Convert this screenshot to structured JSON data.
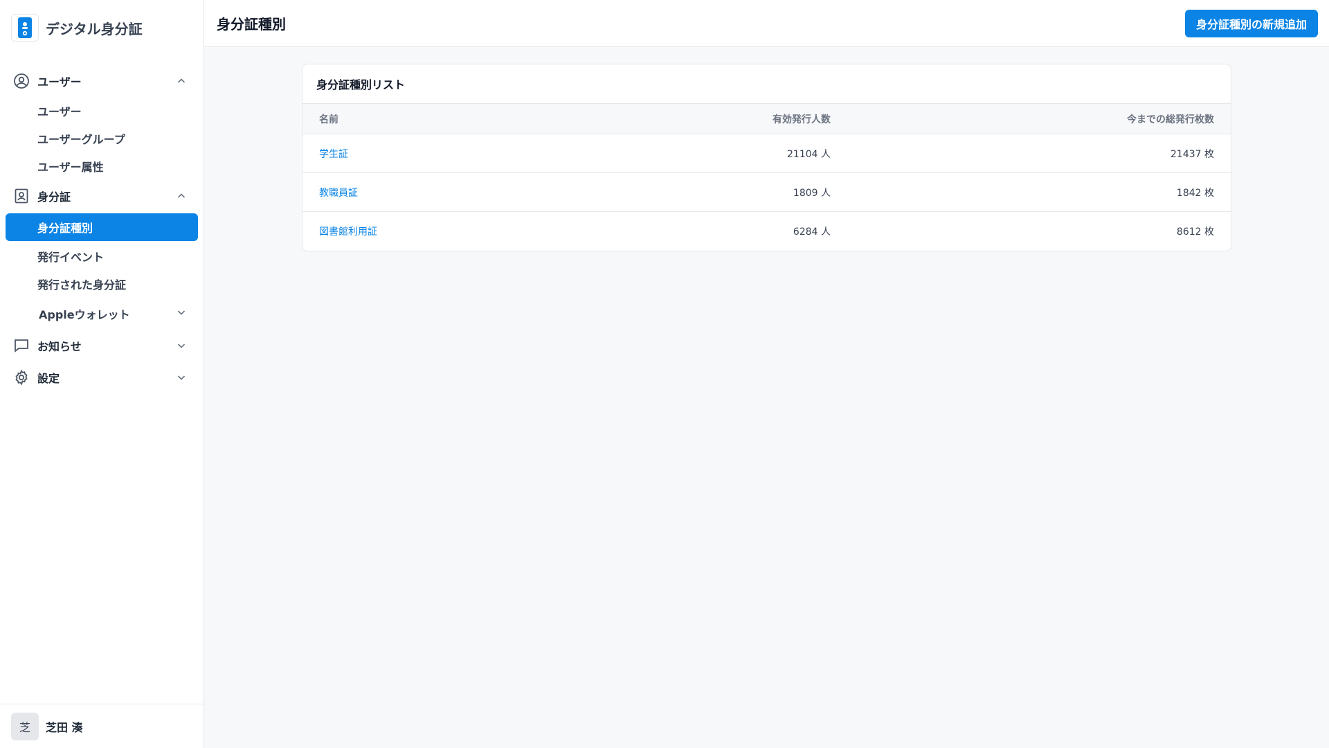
{
  "app": {
    "name": "デジタル身分証"
  },
  "sidebar": {
    "groups": [
      {
        "label": "ユーザー",
        "icon": "user-circle-icon",
        "expanded": true,
        "items": [
          {
            "label": "ユーザー"
          },
          {
            "label": "ユーザーグループ"
          },
          {
            "label": "ユーザー属性"
          }
        ]
      },
      {
        "label": "身分証",
        "icon": "id-badge-icon",
        "expanded": true,
        "items": [
          {
            "label": "身分証種別",
            "active": true
          },
          {
            "label": "発行イベント"
          },
          {
            "label": "発行された身分証"
          }
        ],
        "subgroup": {
          "label": "Appleウォレット",
          "expanded": false
        }
      },
      {
        "label": "お知らせ",
        "icon": "chat-bubble-icon",
        "expanded": false
      },
      {
        "label": "設定",
        "icon": "gear-icon",
        "expanded": false
      }
    ],
    "user": {
      "avatar_initial": "芝",
      "name": "芝田 湊"
    }
  },
  "header": {
    "title": "身分証種別",
    "add_button": "身分証種別の新規追加"
  },
  "card": {
    "title": "身分証種別リスト",
    "columns": {
      "name": "名前",
      "active": "有効発行人数",
      "total": "今までの総発行枚数"
    },
    "rows": [
      {
        "name": "学生証",
        "active": "21104 人",
        "total": "21437 枚"
      },
      {
        "name": "教職員証",
        "active": "1809 人",
        "total": "1842 枚"
      },
      {
        "name": "図書館利用証",
        "active": "6284 人",
        "total": "8612 枚"
      }
    ]
  },
  "colors": {
    "accent": "#0b84e5",
    "background": "#f7f8fa",
    "border": "#e5e7eb"
  }
}
